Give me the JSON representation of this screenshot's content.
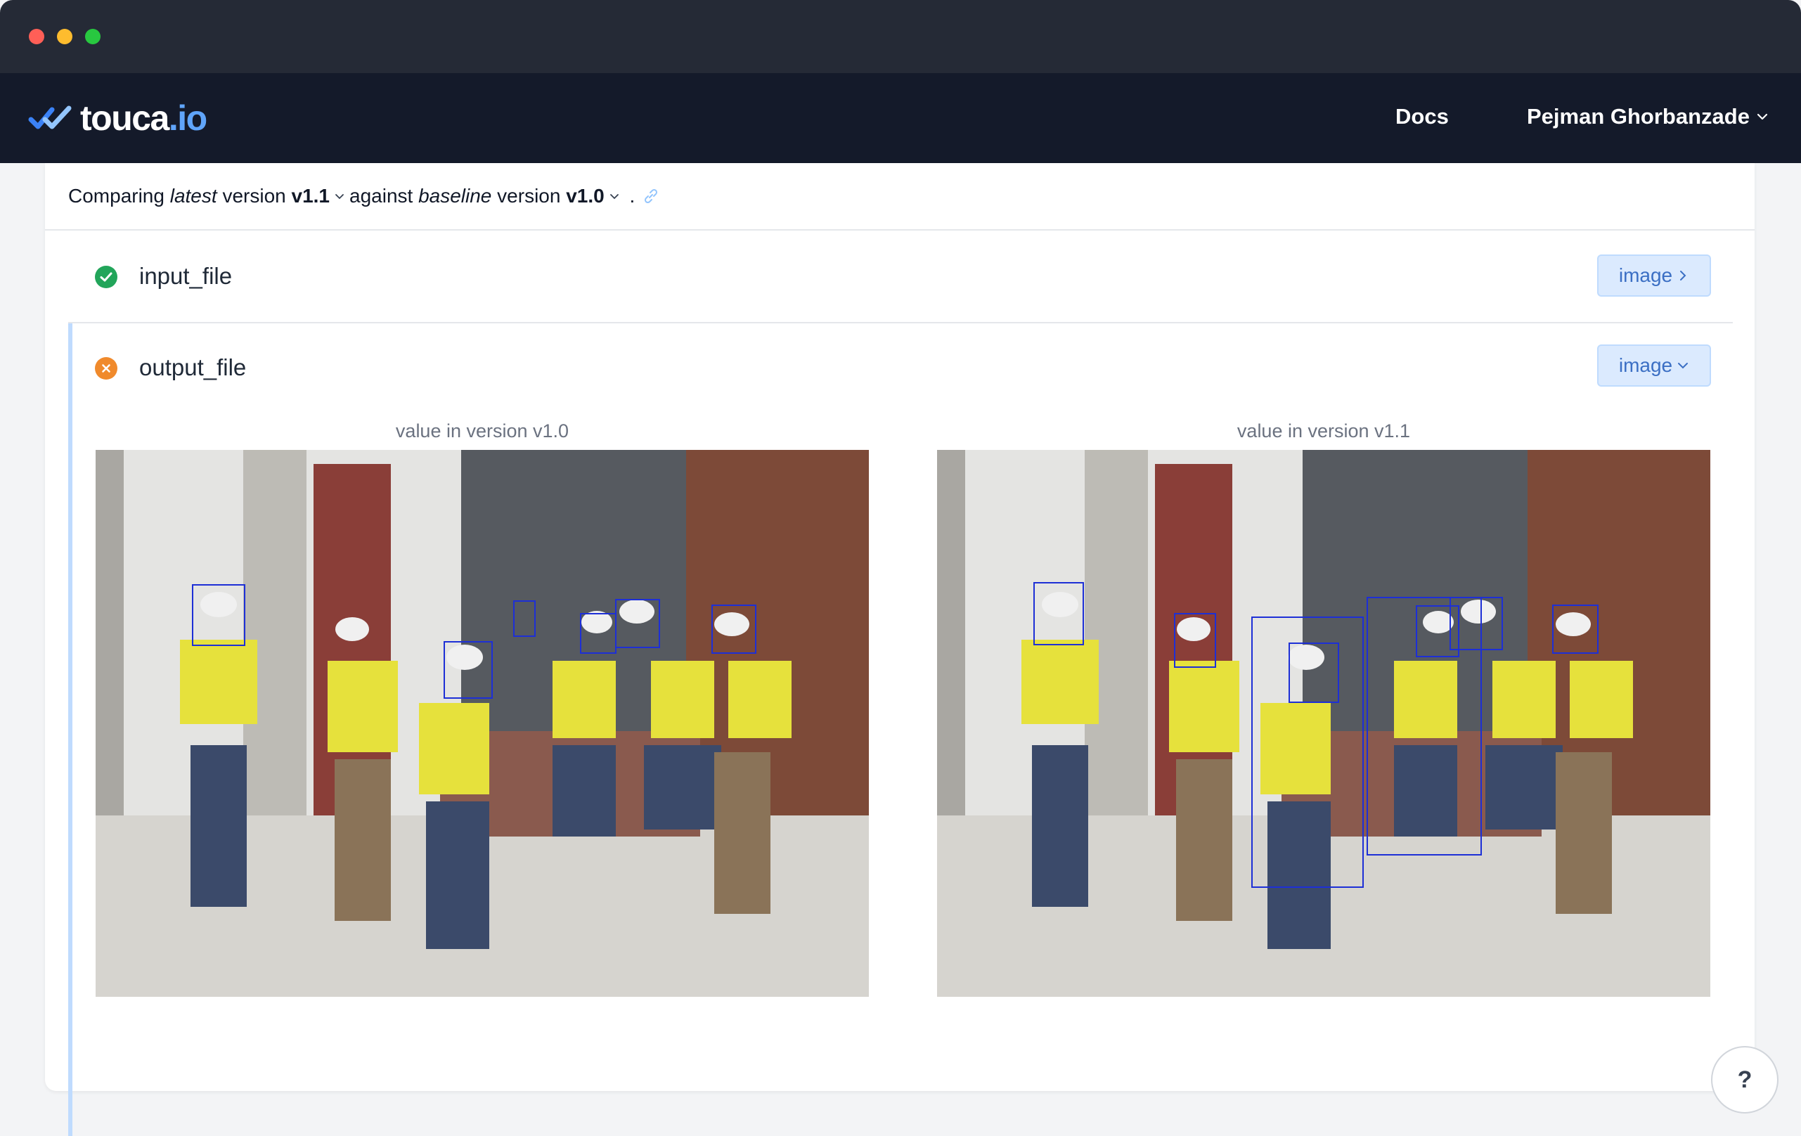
{
  "window": {
    "controls": [
      "close",
      "minimize",
      "zoom"
    ],
    "colors": {
      "close": "#ff5f57",
      "minimize": "#febc2e",
      "zoom": "#28c840"
    }
  },
  "navbar": {
    "brand_name": "touca",
    "brand_tld": ".io",
    "brand_icon": "double-check-icon",
    "docs_label": "Docs",
    "user_name": "Pejman Ghorbanzade",
    "user_menu_icon": "chevron-down-icon"
  },
  "compare": {
    "prefix": "Comparing",
    "latest_word": "latest",
    "version_word_1": "version",
    "latest_version": "v1.1",
    "against": "against",
    "baseline_word": "baseline",
    "version_word_2": "version",
    "baseline_version": "v1.0",
    "period": ".",
    "link_icon": "link-icon"
  },
  "rows": [
    {
      "key": "input_file",
      "status": "pass",
      "status_icon": "check-circle-icon",
      "status_color": "#22a55a",
      "type_label": "image",
      "toggle_icon": "chevron-right-icon"
    },
    {
      "key": "output_file",
      "status": "fail",
      "status_icon": "x-circle-icon",
      "status_color": "#f08a2c",
      "type_label": "image",
      "toggle_icon": "chevron-down-icon",
      "left_label": "value in version v1.0",
      "right_label": "value in version v1.1"
    }
  ],
  "detections": {
    "v1_0_labels": [
      "helmet",
      "helmet",
      "helmet",
      "helmet",
      "helmet",
      "helmet",
      "helmet"
    ],
    "v1_1_labels": [
      "helmet",
      "helmet",
      "person",
      "helmet",
      "helmet",
      "person",
      "helmet",
      "helmet",
      "helmet"
    ],
    "box_color": "#1d2fd6"
  },
  "help": {
    "label": "?"
  }
}
